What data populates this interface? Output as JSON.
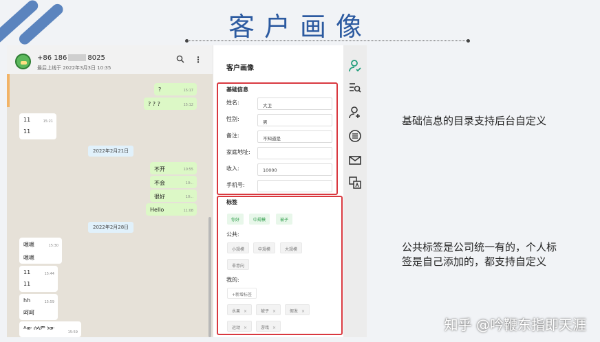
{
  "slide_title": "客户画像",
  "chat": {
    "phone_prefix": "+86 186",
    "phone_suffix": "8025",
    "last_seen": "最后上线于 2022年3月3日 10:35",
    "messages": [
      {
        "text": "?",
        "time": "15:17",
        "dir": "out"
      },
      {
        "text": "? ? ?",
        "time": "15:12",
        "dir": "out"
      },
      {
        "text": "11",
        "time": "15:21",
        "dir": "in"
      },
      {
        "text": "11",
        "time": "",
        "dir": "in"
      },
      {
        "text": "不开",
        "time": "10:55",
        "dir": "out"
      },
      {
        "text": "不会",
        "time": "10:..",
        "dir": "out"
      },
      {
        "text": "很好",
        "time": "10:..",
        "dir": "out"
      },
      {
        "text": "Hello",
        "time": "11:08",
        "dir": "out"
      },
      {
        "text": "嗯嗯",
        "time": "15:30",
        "dir": "in"
      },
      {
        "text": "嗯嗯",
        "time": "",
        "dir": "in"
      },
      {
        "text": "11",
        "time": "15:44",
        "dir": "in"
      },
      {
        "text": "11",
        "time": "",
        "dir": "in"
      },
      {
        "text": "hh",
        "time": "15:59",
        "dir": "in"
      },
      {
        "text": "呵呵",
        "time": "",
        "dir": "in"
      },
      {
        "text": "እው ሰላም ነው",
        "time": "15:59",
        "dir": "in"
      }
    ],
    "dates": [
      "2022年2月21日",
      "2022年2月28日"
    ]
  },
  "panel": {
    "title": "客户画像",
    "basic_info_title": "基础信息",
    "fields": [
      {
        "label": "姓名:",
        "value": "大卫"
      },
      {
        "label": "性别:",
        "value": "男"
      },
      {
        "label": "备注:",
        "value": "不知道是"
      },
      {
        "label": "家庭地址:",
        "value": ""
      },
      {
        "label": "收入:",
        "value": "10000"
      },
      {
        "label": "手机号:",
        "value": ""
      }
    ],
    "tags_title": "标签",
    "selected_tags": [
      "你好",
      "中规模",
      "被子"
    ],
    "public_label": "公共:",
    "public_tags": [
      "小规模",
      "中规模",
      "大规模",
      "非意向"
    ],
    "mine_label": "我的:",
    "add_tag": "+新增标签",
    "my_tags": [
      "水果",
      "被子",
      "假发",
      "运动",
      "游戏"
    ],
    "close_glyph": "×"
  },
  "notes": {
    "basic": "基础信息的目录支持后台自定义",
    "tags_line1": "公共标签是公司统一有的，个人标",
    "tags_line2": "签是自己添加的，都支持自定义"
  },
  "watermark": "知乎 @吟鞭东指即天涯",
  "colors": {
    "title": "#2c5aa0",
    "accent": "#1f9d7a",
    "highlight": "#d9383f"
  }
}
